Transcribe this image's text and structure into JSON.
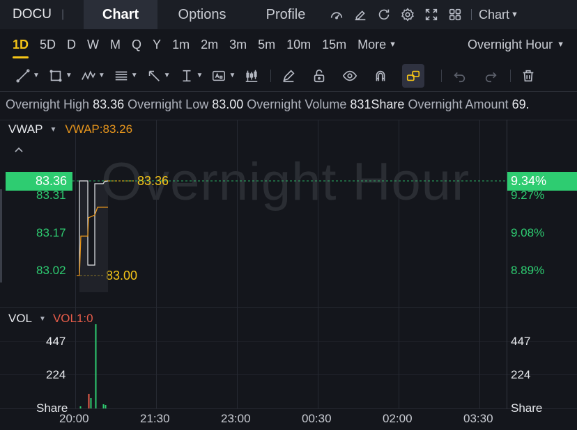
{
  "header": {
    "ticker": "DOCU",
    "separator": "|",
    "tabs": [
      {
        "label": "Chart"
      },
      {
        "label": "Options"
      },
      {
        "label": "Profile"
      }
    ],
    "chart_menu": "Chart"
  },
  "periods": {
    "items": [
      "1D",
      "5D",
      "D",
      "W",
      "M",
      "Q",
      "Y",
      "1m",
      "2m",
      "3m",
      "5m",
      "10m",
      "15m"
    ],
    "more": "More",
    "session": "Overnight Hour"
  },
  "info": {
    "high_label": "Overnight High",
    "high": "83.36",
    "low_label": "Overnight Low",
    "low": "83.00",
    "volume_label": "Overnight Volume",
    "volume": "831Share",
    "amount_label": "Overnight Amount",
    "amount": "69."
  },
  "main_chart": {
    "indicator": "VWAP",
    "vwap_value": "VWAP:83.26",
    "collapse_icon": "chevron-up-icon",
    "watermark": "Overnight Hour",
    "current_price": "83.36",
    "current_pct": "9.34%",
    "price_labels": [
      "83.31",
      "83.17",
      "83.02"
    ],
    "pct_labels": [
      "9.27%",
      "9.08%",
      "8.89%"
    ],
    "high_marker": "83.36",
    "low_marker": "83.00",
    "colors": {
      "up": "#2ecc71",
      "vwap": "#e8961c",
      "marker": "#f5c518"
    }
  },
  "volume_chart": {
    "indicator": "VOL",
    "vol_value": "VOL1:0",
    "left_labels": [
      "447",
      "224",
      "Share"
    ],
    "right_labels": [
      "447",
      "224",
      "Share"
    ]
  },
  "time_axis": [
    "20:00",
    "21:30",
    "23:00",
    "00:30",
    "02:00",
    "03:30"
  ],
  "chart_data": {
    "type": "line",
    "x": [
      "20:00",
      "20:05",
      "20:10",
      "20:15",
      "20:20",
      "20:25",
      "20:30",
      "20:35",
      "20:40",
      "20:45",
      "20:50",
      "20:55"
    ],
    "series": [
      {
        "name": "VWAP",
        "values": [
          83.0,
          83.15,
          83.15,
          83.15,
          83.22,
          83.23,
          83.23,
          83.26,
          83.26,
          83.26,
          83.26,
          83.26
        ]
      }
    ],
    "price_range": [
      83.0,
      83.36
    ],
    "ylim": [
      82.98,
      83.4
    ],
    "volume_ticks": [
      224,
      447
    ],
    "x_axis_ticks": [
      "20:00",
      "21:30",
      "23:00",
      "00:30",
      "02:00",
      "03:30"
    ]
  }
}
